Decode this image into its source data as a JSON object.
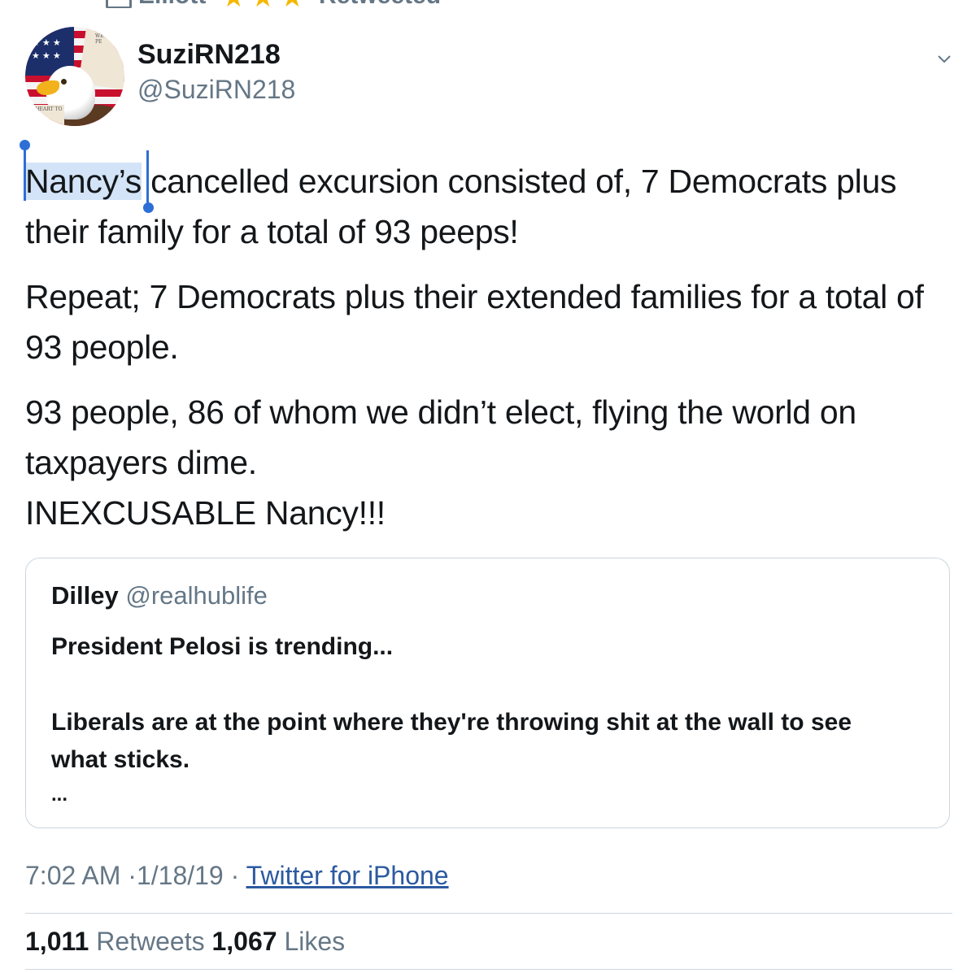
{
  "top_strip": {
    "name_partial": "Elliott",
    "stars": [
      "★",
      "★",
      "★"
    ],
    "retweeted_label": "Retweeted"
  },
  "author": {
    "display_name": "SuziRN218",
    "handle": "@SuziRN218",
    "avatar_text_1": "WE THE PE",
    "avatar_text_2": "RT HEART TO TRUE"
  },
  "tweet": {
    "selected_word": "Nancy’s",
    "paragraph_1_rest": " cancelled  excursion consisted of, 7 Democrats plus their family for a total of 93 peeps!",
    "paragraph_2": "Repeat; 7 Democrats plus their extended families for a total of 93 people.",
    "paragraph_3_line_1": "93 people, 86 of whom we didn’t elect, flying the world on taxpayers dime.",
    "paragraph_3_line_2": "INEXCUSABLE Nancy!!!"
  },
  "quoted_tweet": {
    "name": "Dilley",
    "handle": "@realhublife",
    "line_1": "President Pelosi is trending...",
    "line_2": "Liberals are at the point where they're throwing shit at the wall to see what sticks.",
    "ellipsis": "..."
  },
  "meta": {
    "time": "7:02 AM",
    "date": "1/18/19",
    "separator": "·",
    "source": "Twitter for iPhone"
  },
  "stats": {
    "retweets_count": "1,011",
    "retweets_label": "Retweets",
    "likes_count": "1,067",
    "likes_label": "Likes"
  }
}
